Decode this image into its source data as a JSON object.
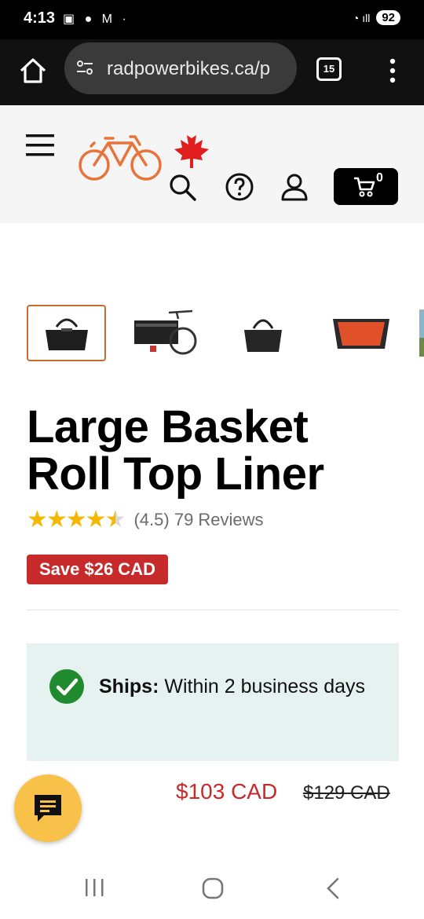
{
  "status_bar": {
    "time": "4:13",
    "battery": "92"
  },
  "browser": {
    "url": "radpowerbikes.ca/p",
    "tab_count": "15"
  },
  "header": {
    "cart_count": "0"
  },
  "product": {
    "title": "Large Basket Roll Top Liner",
    "rating_text": "(4.5) 79 Reviews",
    "save_badge": "Save $26 CAD",
    "ships_label": "Ships:",
    "ships_value": " Within 2 business days",
    "price_now": "$103 CAD",
    "price_was": "$129 CAD",
    "rating": 4.5
  },
  "colors": {
    "accent_orange": "#e8743b",
    "sale_red": "#c72a2a",
    "star": "#f5b800",
    "ships_bg": "#e6f2ef",
    "chat": "#f8c14a"
  }
}
